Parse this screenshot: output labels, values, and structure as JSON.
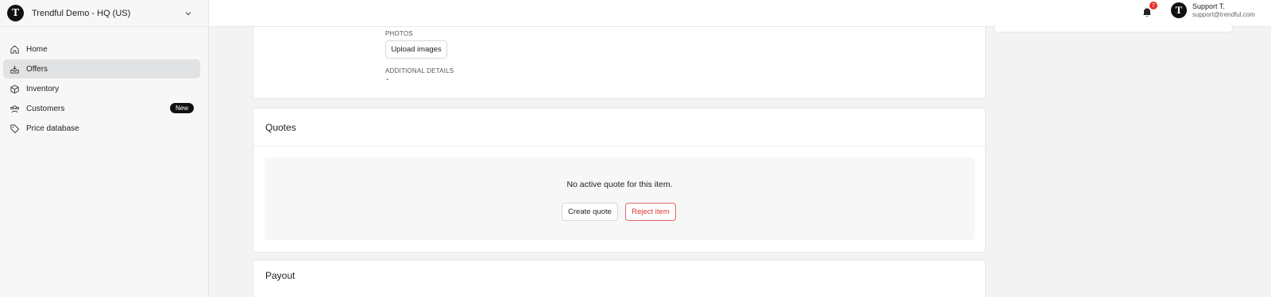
{
  "sidebar": {
    "org_logo_letter": "T",
    "org_name": "Trendful Demo - HQ (US)",
    "items": [
      {
        "label": "Home",
        "icon": "home-icon"
      },
      {
        "label": "Offers",
        "icon": "inbox-download-icon",
        "active": true
      },
      {
        "label": "Inventory",
        "icon": "box-icon"
      },
      {
        "label": "Customers",
        "icon": "users-icon",
        "badge": "New"
      },
      {
        "label": "Price database",
        "icon": "tag-icon"
      }
    ]
  },
  "topbar": {
    "notification_count": "7",
    "user_avatar_letter": "T",
    "user_name": "Support T.",
    "user_email": "support@trendful.com"
  },
  "details": {
    "photos_label": "PHOTOS",
    "upload_button": "Upload images",
    "additional_label": "ADDITIONAL DETAILS",
    "additional_value": "-"
  },
  "quotes": {
    "title": "Quotes",
    "empty_text": "No active quote for this item.",
    "create_button": "Create quote",
    "reject_button": "Reject item"
  },
  "payout": {
    "title": "Payout"
  },
  "colors": {
    "accent_danger": "#d9372f",
    "badge_bg": "#111111",
    "active_nav_bg": "#e1e2e4"
  }
}
